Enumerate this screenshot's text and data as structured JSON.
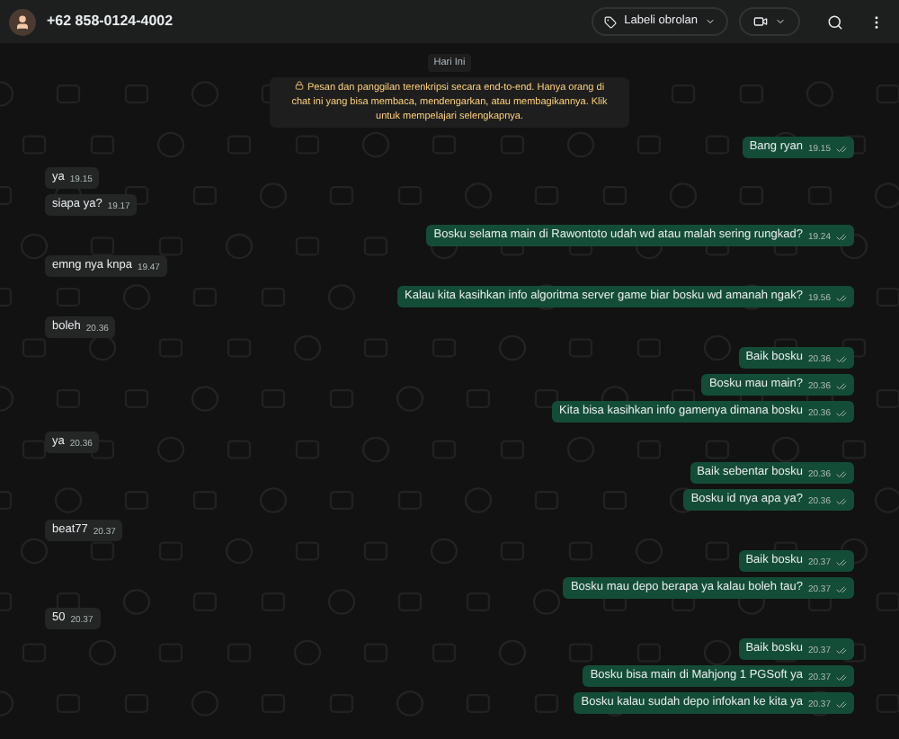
{
  "header": {
    "contact": "+62 858-0124-4002",
    "label_button": "Labeli obrolan"
  },
  "date_chip": "Hari Ini",
  "encryption_notice": "Pesan dan panggilan terenkripsi secara end-to-end. Hanya orang di chat ini yang bisa membaca, mendengarkan, atau membagikannya. Klik untuk mempelajari selengkapnya.",
  "groups": [
    {
      "kind": "out",
      "messages": [
        {
          "text": "Bang ryan",
          "time": "19.15"
        }
      ]
    },
    {
      "kind": "in",
      "messages": [
        {
          "text": "ya",
          "time": "19.15"
        },
        {
          "text": "siapa ya?",
          "time": "19.17"
        }
      ]
    },
    {
      "kind": "out",
      "messages": [
        {
          "text": "Bosku selama main di Rawontoto udah wd atau malah sering rungkad?",
          "time": "19.24"
        }
      ]
    },
    {
      "kind": "in",
      "messages": [
        {
          "text": "emng nya knpa",
          "time": "19.47"
        }
      ]
    },
    {
      "kind": "out",
      "messages": [
        {
          "text": "Kalau kita kasihkan info algoritma server game biar bosku wd amanah ngak?",
          "time": "19.56"
        }
      ]
    },
    {
      "kind": "in",
      "messages": [
        {
          "text": "boleh",
          "time": "20.36"
        }
      ]
    },
    {
      "kind": "out",
      "messages": [
        {
          "text": "Baik bosku",
          "time": "20.36"
        },
        {
          "text": "Bosku mau main?",
          "time": "20.36"
        },
        {
          "text": "Kita bisa kasihkan info gamenya dimana bosku",
          "time": "20.36"
        }
      ]
    },
    {
      "kind": "in",
      "messages": [
        {
          "text": "ya",
          "time": "20.36"
        }
      ]
    },
    {
      "kind": "out",
      "messages": [
        {
          "text": "Baik sebentar bosku",
          "time": "20.36"
        },
        {
          "text": "Bosku id nya apa ya?",
          "time": "20.36"
        }
      ]
    },
    {
      "kind": "in",
      "messages": [
        {
          "text": "beat77",
          "time": "20.37"
        }
      ]
    },
    {
      "kind": "out",
      "messages": [
        {
          "text": "Baik bosku",
          "time": "20.37"
        },
        {
          "text": "Bosku mau depo berapa ya kalau boleh tau?",
          "time": "20.37"
        }
      ]
    },
    {
      "kind": "in",
      "messages": [
        {
          "text": "50",
          "time": "20.37"
        }
      ]
    },
    {
      "kind": "out",
      "messages": [
        {
          "text": "Baik bosku",
          "time": "20.37"
        },
        {
          "text": "Bosku bisa main di Mahjong 1 PGSoft ya",
          "time": "20.37"
        },
        {
          "text": "Bosku kalau sudah depo infokan ke kita ya",
          "time": "20.37"
        }
      ]
    }
  ]
}
